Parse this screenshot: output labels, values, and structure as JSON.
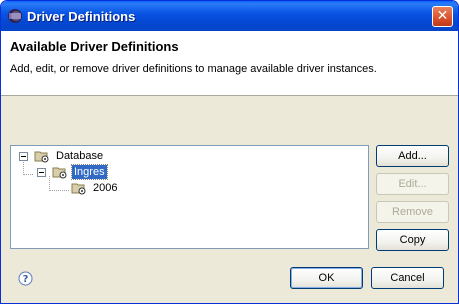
{
  "window": {
    "title": "Driver Definitions"
  },
  "header": {
    "title": "Available Driver Definitions",
    "description": "Add, edit, or remove driver definitions to manage available driver instances."
  },
  "tree": {
    "items": [
      {
        "label": "Database",
        "expanded": true,
        "selected": false
      },
      {
        "label": "Ingres",
        "expanded": true,
        "selected": true
      },
      {
        "label": "2006",
        "expanded": false,
        "selected": false
      }
    ]
  },
  "side_buttons": {
    "add": "Add...",
    "edit": "Edit...",
    "remove": "Remove",
    "copy": "Copy"
  },
  "footer": {
    "ok": "OK",
    "cancel": "Cancel"
  },
  "colors": {
    "titlebar": "#0a55e5",
    "selection": "#316ac5",
    "dialog_bg": "#ece9d8"
  }
}
